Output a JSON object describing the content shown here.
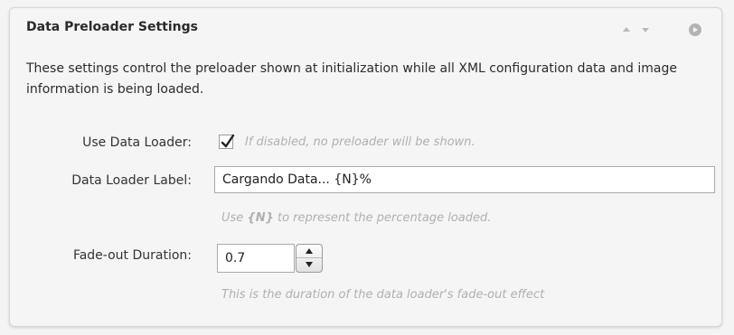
{
  "panel": {
    "title": "Data Preloader Settings",
    "description": "These settings control the preloader shown at initialization while all XML configuration data and image information is being loaded."
  },
  "fields": {
    "use_data_loader": {
      "label": "Use Data Loader:",
      "checked": true,
      "hint": "If disabled, no preloader will be shown."
    },
    "data_loader_label": {
      "label": "Data Loader Label:",
      "value": "Cargando Data... {N}%",
      "hint_prefix": "Use",
      "hint_token": "{N}",
      "hint_suffix": "to represent the percentage loaded."
    },
    "fade_out_duration": {
      "label": "Fade-out Duration:",
      "value": "0.7",
      "hint": "This is the duration of the data loader's fade-out effect"
    }
  }
}
